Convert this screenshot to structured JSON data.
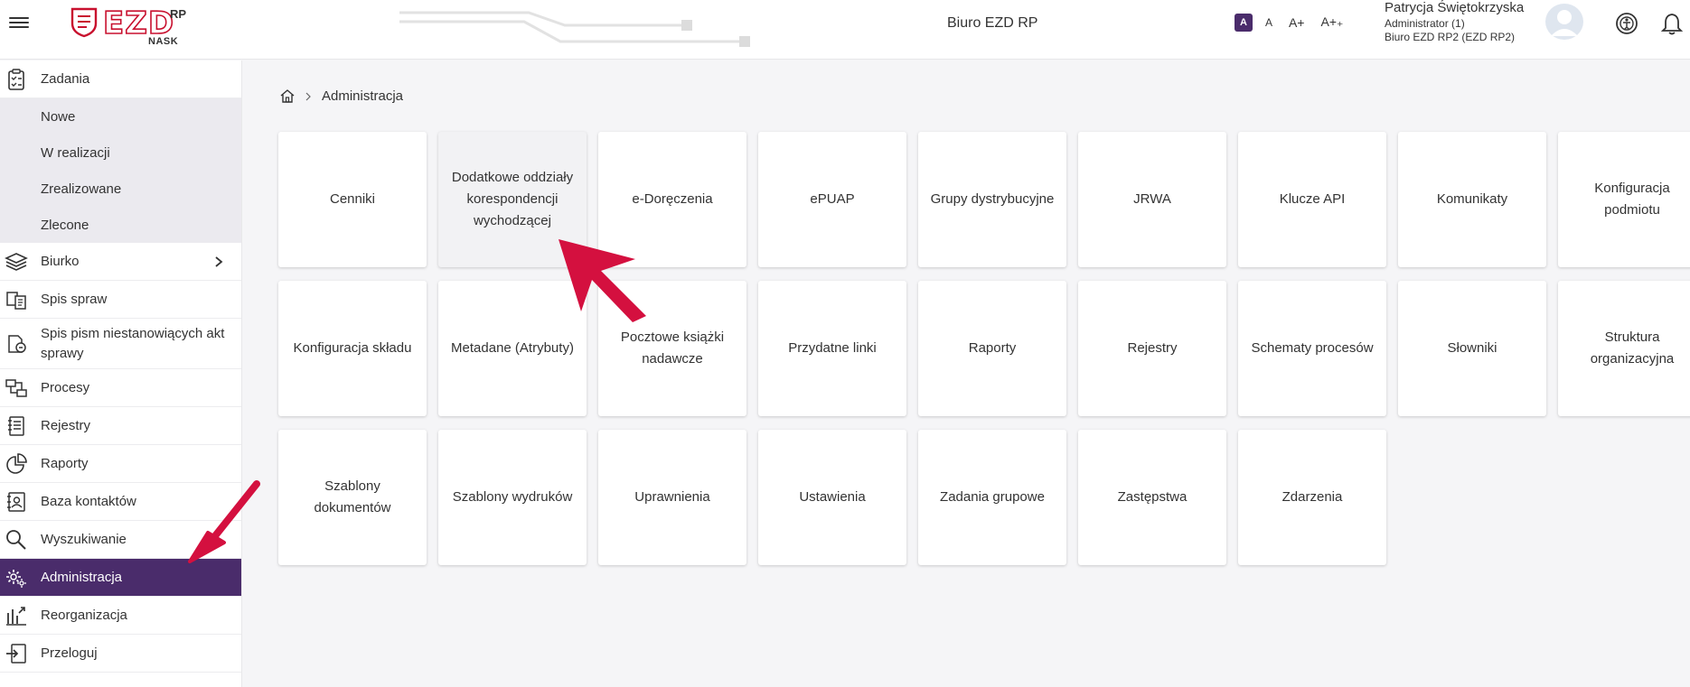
{
  "header": {
    "app_name": "EZD",
    "app_superscript": "RP",
    "logo_subtitle": "NASK",
    "center_title": "Biuro EZD RP",
    "font_sizes": [
      "A",
      "A",
      "A+",
      "A+₊"
    ],
    "user": {
      "name": "Patrycja Świętokrzyska",
      "role": "Administrator (1)",
      "office": "Biuro EZD RP2 (EZD RP2)"
    }
  },
  "sidebar": {
    "items": [
      {
        "label": "Zadania",
        "icon": "clipboard-tasks-icon"
      },
      {
        "label": "Biurko",
        "icon": "layers-icon"
      },
      {
        "label": "Spis spraw",
        "icon": "cases-icon"
      },
      {
        "label": "Spis pism niestanowiących akt sprawy",
        "icon": "documents-icon"
      },
      {
        "label": "Procesy",
        "icon": "process-icon"
      },
      {
        "label": "Rejestry",
        "icon": "register-icon"
      },
      {
        "label": "Raporty",
        "icon": "pie-chart-icon"
      },
      {
        "label": "Baza kontaktów",
        "icon": "contacts-icon"
      },
      {
        "label": "Wyszukiwanie",
        "icon": "search-icon"
      },
      {
        "label": "Administracja",
        "icon": "gear-icon"
      },
      {
        "label": "Reorganizacja",
        "icon": "reorganize-icon"
      },
      {
        "label": "Przeloguj",
        "icon": "relogin-icon"
      }
    ],
    "subitems": [
      "Nowe",
      "W realizacji",
      "Zrealizowane",
      "Zlecone"
    ]
  },
  "breadcrumb": {
    "current": "Administracja"
  },
  "tiles": [
    "Cenniki",
    "Dodatkowe oddziały korespondencji wychodzącej",
    "e-Doręczenia",
    "ePUAP",
    "Grupy dystrybucyjne",
    "JRWA",
    "Klucze API",
    "Komunikaty",
    "Konfiguracja podmiotu",
    "Konfiguracja składu",
    "Metadane (Atrybuty)",
    "Pocztowe książki nadawcze",
    "Przydatne linki",
    "Raporty",
    "Rejestry",
    "Schematy procesów",
    "Słowniki",
    "Struktura organizacyjna",
    "Szablony dokumentów",
    "Szablony wydruków",
    "Uprawnienia",
    "Ustawienia",
    "Zadania grupowe",
    "Zastępstwa",
    "Zdarzenia"
  ],
  "colors": {
    "accent": "#4a2c6b",
    "brand_red": "#c8102e",
    "annotation_arrow": "#d4103f"
  }
}
